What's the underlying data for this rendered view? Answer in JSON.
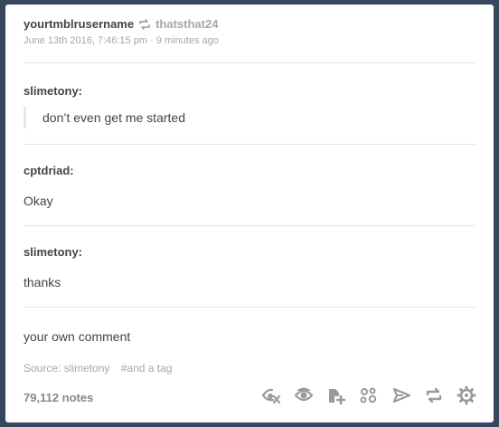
{
  "post": {
    "blog_name": "yourtmblrusername",
    "reblog_icon": "reblog-icon",
    "reblogged_from": "thatsthat24",
    "timestamp": "June 13th 2016, 7:46:15 pm",
    "separator": "·",
    "relative_time": "9 minutes ago"
  },
  "thread": [
    {
      "author": "slimetony:",
      "text": "don’t even get me started",
      "quoted": true
    },
    {
      "author": "cptdriad:",
      "text": "Okay"
    },
    {
      "author": "slimetony:",
      "text": "thanks"
    }
  ],
  "comment": "your own comment",
  "footer": {
    "source": "Source: slimetony",
    "tag": "#and a tag",
    "notes": "79,112 notes"
  },
  "actions": [
    {
      "icon": "eye-hide-icon"
    },
    {
      "icon": "eye-icon"
    },
    {
      "icon": "queue-add-icon"
    },
    {
      "icon": "share-dots-icon"
    },
    {
      "icon": "send-icon"
    },
    {
      "icon": "reblog-icon"
    },
    {
      "icon": "gear-icon"
    }
  ],
  "colors": {
    "background": "#36465d",
    "card": "#ffffff",
    "text": "#444444",
    "muted": "#a7a7a7",
    "icon": "#9a9a9a"
  }
}
